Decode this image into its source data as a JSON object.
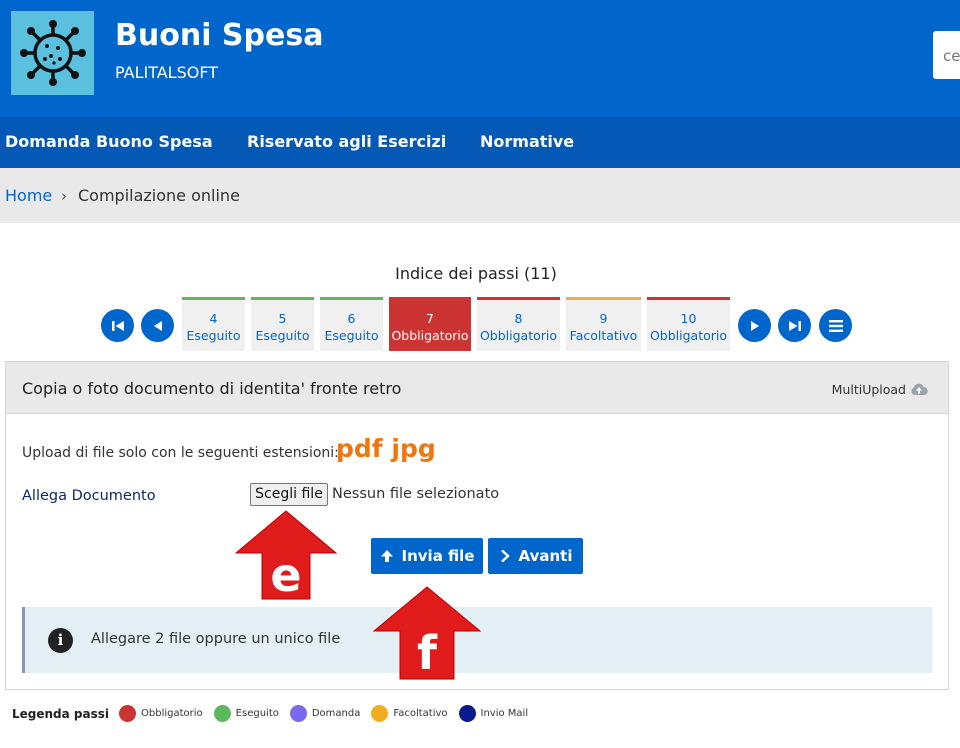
{
  "header": {
    "title": "Buoni Spesa",
    "subtitle": "PALITALSOFT",
    "search_partial": "ce"
  },
  "nav": {
    "items": [
      {
        "label": "Domanda Buono Spesa"
      },
      {
        "label": "Riservato agli Esercizi"
      },
      {
        "label": "Normative"
      }
    ]
  },
  "breadcrumb": {
    "home": "Home",
    "separator": "›",
    "current": "Compilazione online"
  },
  "steps": {
    "title": "Indice dei passi (11)",
    "items": [
      {
        "num": "4",
        "label": "Eseguito",
        "color": "#5cb85c"
      },
      {
        "num": "5",
        "label": "Eseguito",
        "color": "#5cb85c"
      },
      {
        "num": "6",
        "label": "Eseguito",
        "color": "#5cb85c"
      },
      {
        "num": "7",
        "label": "Obbligatorio",
        "color": "#cc3333",
        "active": true
      },
      {
        "num": "8",
        "label": "Obbligatorio",
        "color": "#cc3333"
      },
      {
        "num": "9",
        "label": "Facoltativo",
        "color": "#f0ad4e"
      },
      {
        "num": "10",
        "label": "Obbligatorio",
        "color": "#cc3333"
      }
    ]
  },
  "panel": {
    "title": "Copia o foto documento di identita' fronte retro",
    "multiupload": "MultiUpload",
    "ext_label": "Upload di file solo con le seguenti estensioni:",
    "ext_value": "pdf jpg",
    "attach_label": "Allega Documento",
    "file_button": "Scegli file",
    "file_none": "Nessun file selezionato",
    "send_button": "Invia file",
    "next_button": "Avanti",
    "info_text": "Allegare 2 file oppure un unico file"
  },
  "annotations": {
    "e": "e",
    "f": "f"
  },
  "legend": {
    "title": "Legenda passi",
    "items": [
      {
        "label": "Obbligatorio",
        "color": "#cc3333"
      },
      {
        "label": "Eseguito",
        "color": "#5cb85c"
      },
      {
        "label": "Domanda",
        "color": "#7b68ee"
      },
      {
        "label": "Facoltativo",
        "color": "#f0ad1e"
      },
      {
        "label": "Invio Mail",
        "color": "#0b1a8a"
      }
    ]
  }
}
